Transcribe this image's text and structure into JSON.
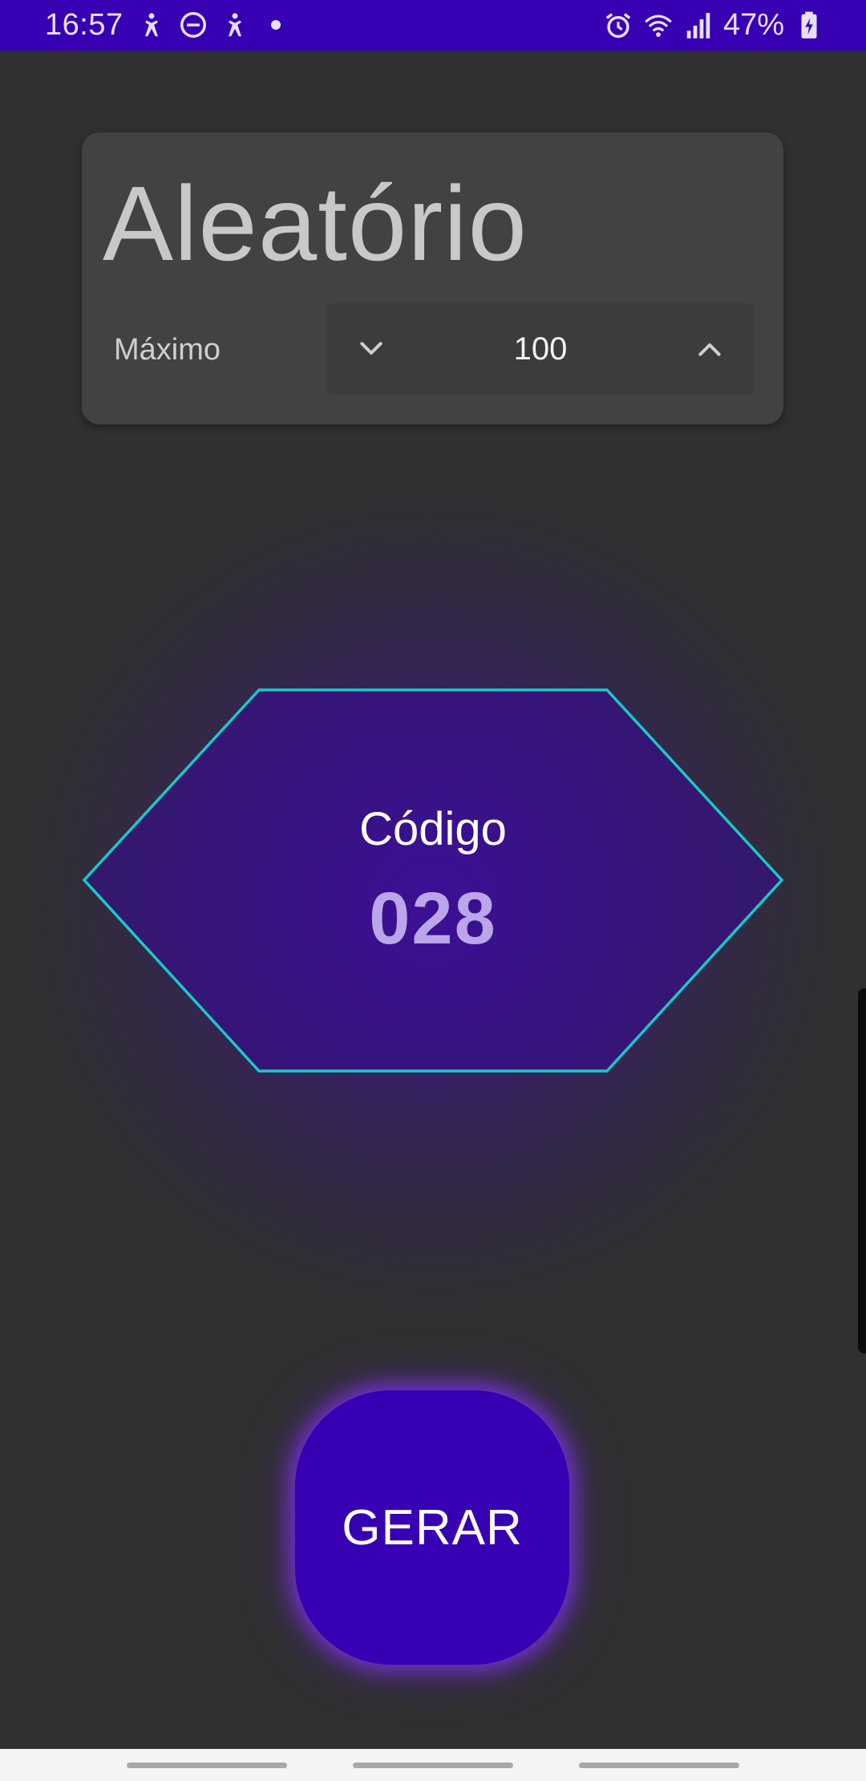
{
  "status_bar": {
    "time": "16:57",
    "battery": "47%",
    "icons_left": [
      "accessibility-icon",
      "do-not-disturb-icon",
      "accessibility-icon",
      "notification-dot"
    ],
    "icons_right": [
      "alarm-icon",
      "wifi-icon",
      "signal-icon",
      "battery-charging-icon"
    ]
  },
  "header": {
    "title": "Aleatório",
    "max_label": "Máximo",
    "max_value": "100"
  },
  "result": {
    "label": "Código",
    "value": "028"
  },
  "actions": {
    "generate_label": "GERAR"
  },
  "colors": {
    "primary": "#3700b3",
    "background": "#303030",
    "card": "#424242",
    "hexagon_border": "#19c8c8",
    "code_value": "#bba6ea"
  }
}
